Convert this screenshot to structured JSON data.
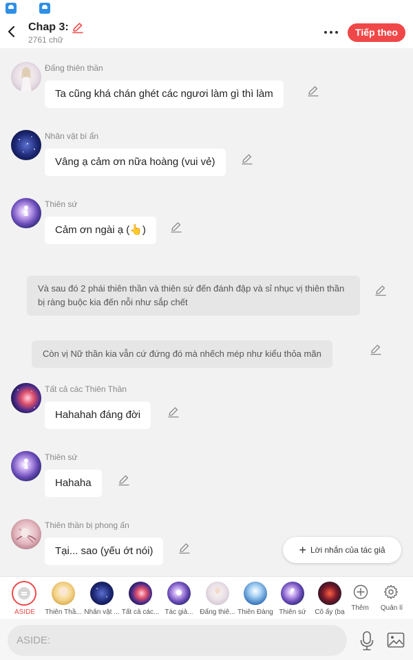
{
  "header": {
    "title": "Chap 3:",
    "word_count": "2761 chữ",
    "next_label": "Tiếp theo"
  },
  "messages": [
    {
      "type": "char",
      "name": "Đấng thiên thần",
      "text": "Ta cũng khá chán ghét các ngươi làm gì thì làm",
      "avatar": "angel-white"
    },
    {
      "type": "char",
      "name": "Nhân vật bí ẩn",
      "text": "Vâng ạ cảm ơn nữa hoàng (vui vẻ)",
      "avatar": "galaxy-dark"
    },
    {
      "type": "char",
      "name": "Thiên sứ",
      "text": "Cảm ơn ngài ạ (👆)",
      "avatar": "purple-galaxy"
    },
    {
      "type": "aside",
      "text": "Và sau đó 2 phái thiên thần và thiên sứ đến đánh đập và sỉ nhục vị thiên thần bị ràng buộc kia đến nỗi như sắp chết"
    },
    {
      "type": "aside",
      "text": "Còn vị Nữ thần kia vẫn cứ đứng đó mà nhếch mép như kiểu thỏa mãn"
    },
    {
      "type": "char",
      "name": "Tất cả các Thiên Thần",
      "text": "Hahahah đáng đời",
      "avatar": "nebula-red"
    },
    {
      "type": "char",
      "name": "Thiên sứ",
      "text": "Hahaha",
      "avatar": "purple-galaxy"
    },
    {
      "type": "char",
      "name": "Thiên thần bị phong ấn",
      "text": "Tại... sao (yếu ớt nói)",
      "avatar": "chained-angel"
    }
  ],
  "author_note": "Lời nhắn của tác giả",
  "characters": [
    {
      "label": "ASIDE",
      "selected": true
    },
    {
      "label": "Thiên Thầ..."
    },
    {
      "label": "Nhân vật ..."
    },
    {
      "label": "Tất cả các..."
    },
    {
      "label": "Tác giả..."
    },
    {
      "label": "Đấng thiê..."
    },
    {
      "label": "Thiên Đàng"
    },
    {
      "label": "Thiên sứ"
    },
    {
      "label": "Cô ấy (bạ"
    },
    {
      "label": "Thêm"
    },
    {
      "label": "Quản lí"
    }
  ],
  "input": {
    "placeholder": "ASIDE:"
  },
  "colors": {
    "accent": "#f04848",
    "bubble": "#ffffff",
    "aside_bubble": "#e6e6e6",
    "background": "#f2f2f2"
  },
  "icons": [
    "back-arrow-icon",
    "edit-pencil-icon",
    "more-dots-icon",
    "plus-icon",
    "microphone-icon",
    "image-icon",
    "settings-gear-icon",
    "add-circle-icon"
  ]
}
